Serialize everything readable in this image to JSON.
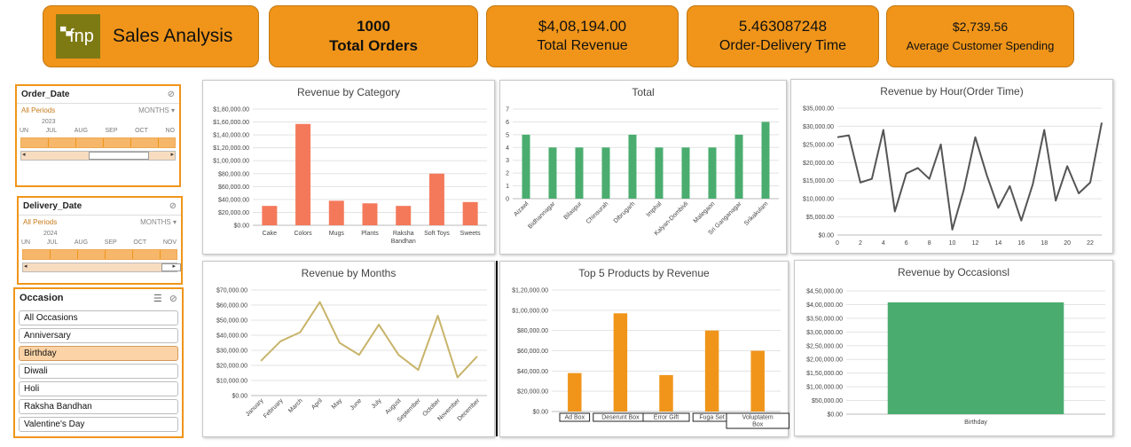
{
  "header": {
    "logo_text": "fnp",
    "app_title": "Sales Analysis"
  },
  "kpis": [
    {
      "value": "1000",
      "label": "Total Orders"
    },
    {
      "value": "$4,08,194.00",
      "label": "Total Revenue"
    },
    {
      "value": "5.463087248",
      "label": "Order-Delivery Time"
    },
    {
      "value": "$2,739.56",
      "label": "Average Customer Spending"
    }
  ],
  "order_date": {
    "title": "Order_Date",
    "periods": "All Periods",
    "unit": "MONTHS",
    "year": "2023",
    "months": [
      "UN",
      "JUL",
      "AUG",
      "SEP",
      "OCT",
      "NO"
    ]
  },
  "delivery_date": {
    "title": "Delivery_Date",
    "periods": "All Periods",
    "unit": "MONTHS",
    "year": "2024",
    "months": [
      "UN",
      "JUL",
      "AUG",
      "SEP",
      "OCT",
      "NOV"
    ]
  },
  "occasion": {
    "title": "Occasion",
    "items": [
      "All Occasions",
      "Anniversary",
      "Birthday",
      "Diwali",
      "Holi",
      "Raksha Bandhan",
      "Valentine's Day"
    ],
    "selected": "Birthday"
  },
  "colors": {
    "orange": "#f0951a",
    "salmon": "#f4795b",
    "green": "#4aad6f",
    "gray": "#555555",
    "khaki": "#c8b46a"
  },
  "chart_data": [
    {
      "id": "cat",
      "type": "bar",
      "title": "Revenue by Category",
      "categories": [
        "Cake",
        "Colors",
        "Mugs",
        "Plants",
        "Raksha Bandhan",
        "Soft Toys",
        "Sweets"
      ],
      "values": [
        30000,
        157000,
        38000,
        34000,
        30000,
        80000,
        36000
      ],
      "ylim": [
        0,
        180000
      ],
      "yticks": [
        "$0.00",
        "$20,000.00",
        "$40,000.00",
        "$60,000.00",
        "$80,000.00",
        "$1,00,000.00",
        "$1,20,000.00",
        "$1,40,000.00",
        "$1,60,000.00",
        "$1,80,000.00"
      ],
      "color": "#f4795b"
    },
    {
      "id": "total",
      "type": "bar",
      "title": "Total",
      "categories": [
        "Aizawl",
        "Bidhannagar",
        "Bilaspur",
        "Chinsurah",
        "Dibrugarh",
        "Imphal",
        "Kalyan-Dombivli",
        "Malegaon",
        "Sri Ganganagar",
        "Srikakulam"
      ],
      "values": [
        5,
        4,
        4,
        4,
        5,
        4,
        4,
        4,
        5,
        6
      ],
      "ylim": [
        0,
        7
      ],
      "yticks": [
        "0",
        "1",
        "2",
        "3",
        "4",
        "5",
        "6",
        "7"
      ],
      "color": "#4aad6f"
    },
    {
      "id": "hour",
      "type": "line",
      "title": "Revenue by Hour(Order Time)",
      "x": [
        0,
        1,
        2,
        3,
        4,
        5,
        6,
        7,
        8,
        9,
        10,
        11,
        12,
        13,
        14,
        15,
        16,
        17,
        18,
        19,
        20,
        21,
        22,
        23
      ],
      "values": [
        27000,
        27500,
        14500,
        15500,
        29000,
        6500,
        17000,
        18500,
        15500,
        25000,
        1500,
        12500,
        27000,
        16500,
        7500,
        13500,
        4000,
        14000,
        29000,
        9500,
        19000,
        11500,
        14500,
        31000
      ],
      "ylim": [
        0,
        35000
      ],
      "xticks": [
        "0",
        "2",
        "4",
        "6",
        "8",
        "10",
        "12",
        "14",
        "16",
        "18",
        "20",
        "22"
      ],
      "yticks": [
        "$0.00",
        "$5,000.00",
        "$10,000.00",
        "$15,000.00",
        "$20,000.00",
        "$25,000.00",
        "$30,000.00",
        "$35,000.00"
      ],
      "color": "#555555"
    },
    {
      "id": "months",
      "type": "line",
      "title": "Revenue by Months",
      "categories": [
        "January",
        "February",
        "March",
        "April",
        "May",
        "June",
        "July",
        "August",
        "September",
        "October",
        "November",
        "December"
      ],
      "values": [
        23000,
        36000,
        42000,
        62000,
        35000,
        27000,
        47000,
        27000,
        17000,
        53000,
        12000,
        26000
      ],
      "ylim": [
        0,
        70000
      ],
      "yticks": [
        "$0.00",
        "$10,000.00",
        "$20,000.00",
        "$30,000.00",
        "$40,000.00",
        "$50,000.00",
        "$60,000.00",
        "$70,000.00"
      ],
      "color": "#c8b46a"
    },
    {
      "id": "top5",
      "type": "bar",
      "title": "Top 5 Products by Revenue",
      "categories": [
        "Ad Box",
        "Deserunt Box",
        "Error Gift",
        "Fuga Set",
        "Voluptatem Box"
      ],
      "values": [
        38000,
        97000,
        36000,
        80000,
        60000
      ],
      "ylim": [
        0,
        120000
      ],
      "yticks": [
        "$0.00",
        "$20,000.00",
        "$40,000.00",
        "$60,000.00",
        "$80,000.00",
        "$1,00,000.00",
        "$1,20,000.00"
      ],
      "color": "#f0951a"
    },
    {
      "id": "occ",
      "type": "bar",
      "title": "Revenue by Occasionsl",
      "categories": [
        "Birthday"
      ],
      "values": [
        408194
      ],
      "ylim": [
        0,
        450000
      ],
      "yticks": [
        "$0.00",
        "$50,000.00",
        "$1,00,000.00",
        "$1,50,000.00",
        "$2,00,000.00",
        "$2,50,000.00",
        "$3,00,000.00",
        "$3,50,000.00",
        "$4,00,000.00",
        "$4,50,000.00"
      ],
      "color": "#4aad6f"
    }
  ]
}
